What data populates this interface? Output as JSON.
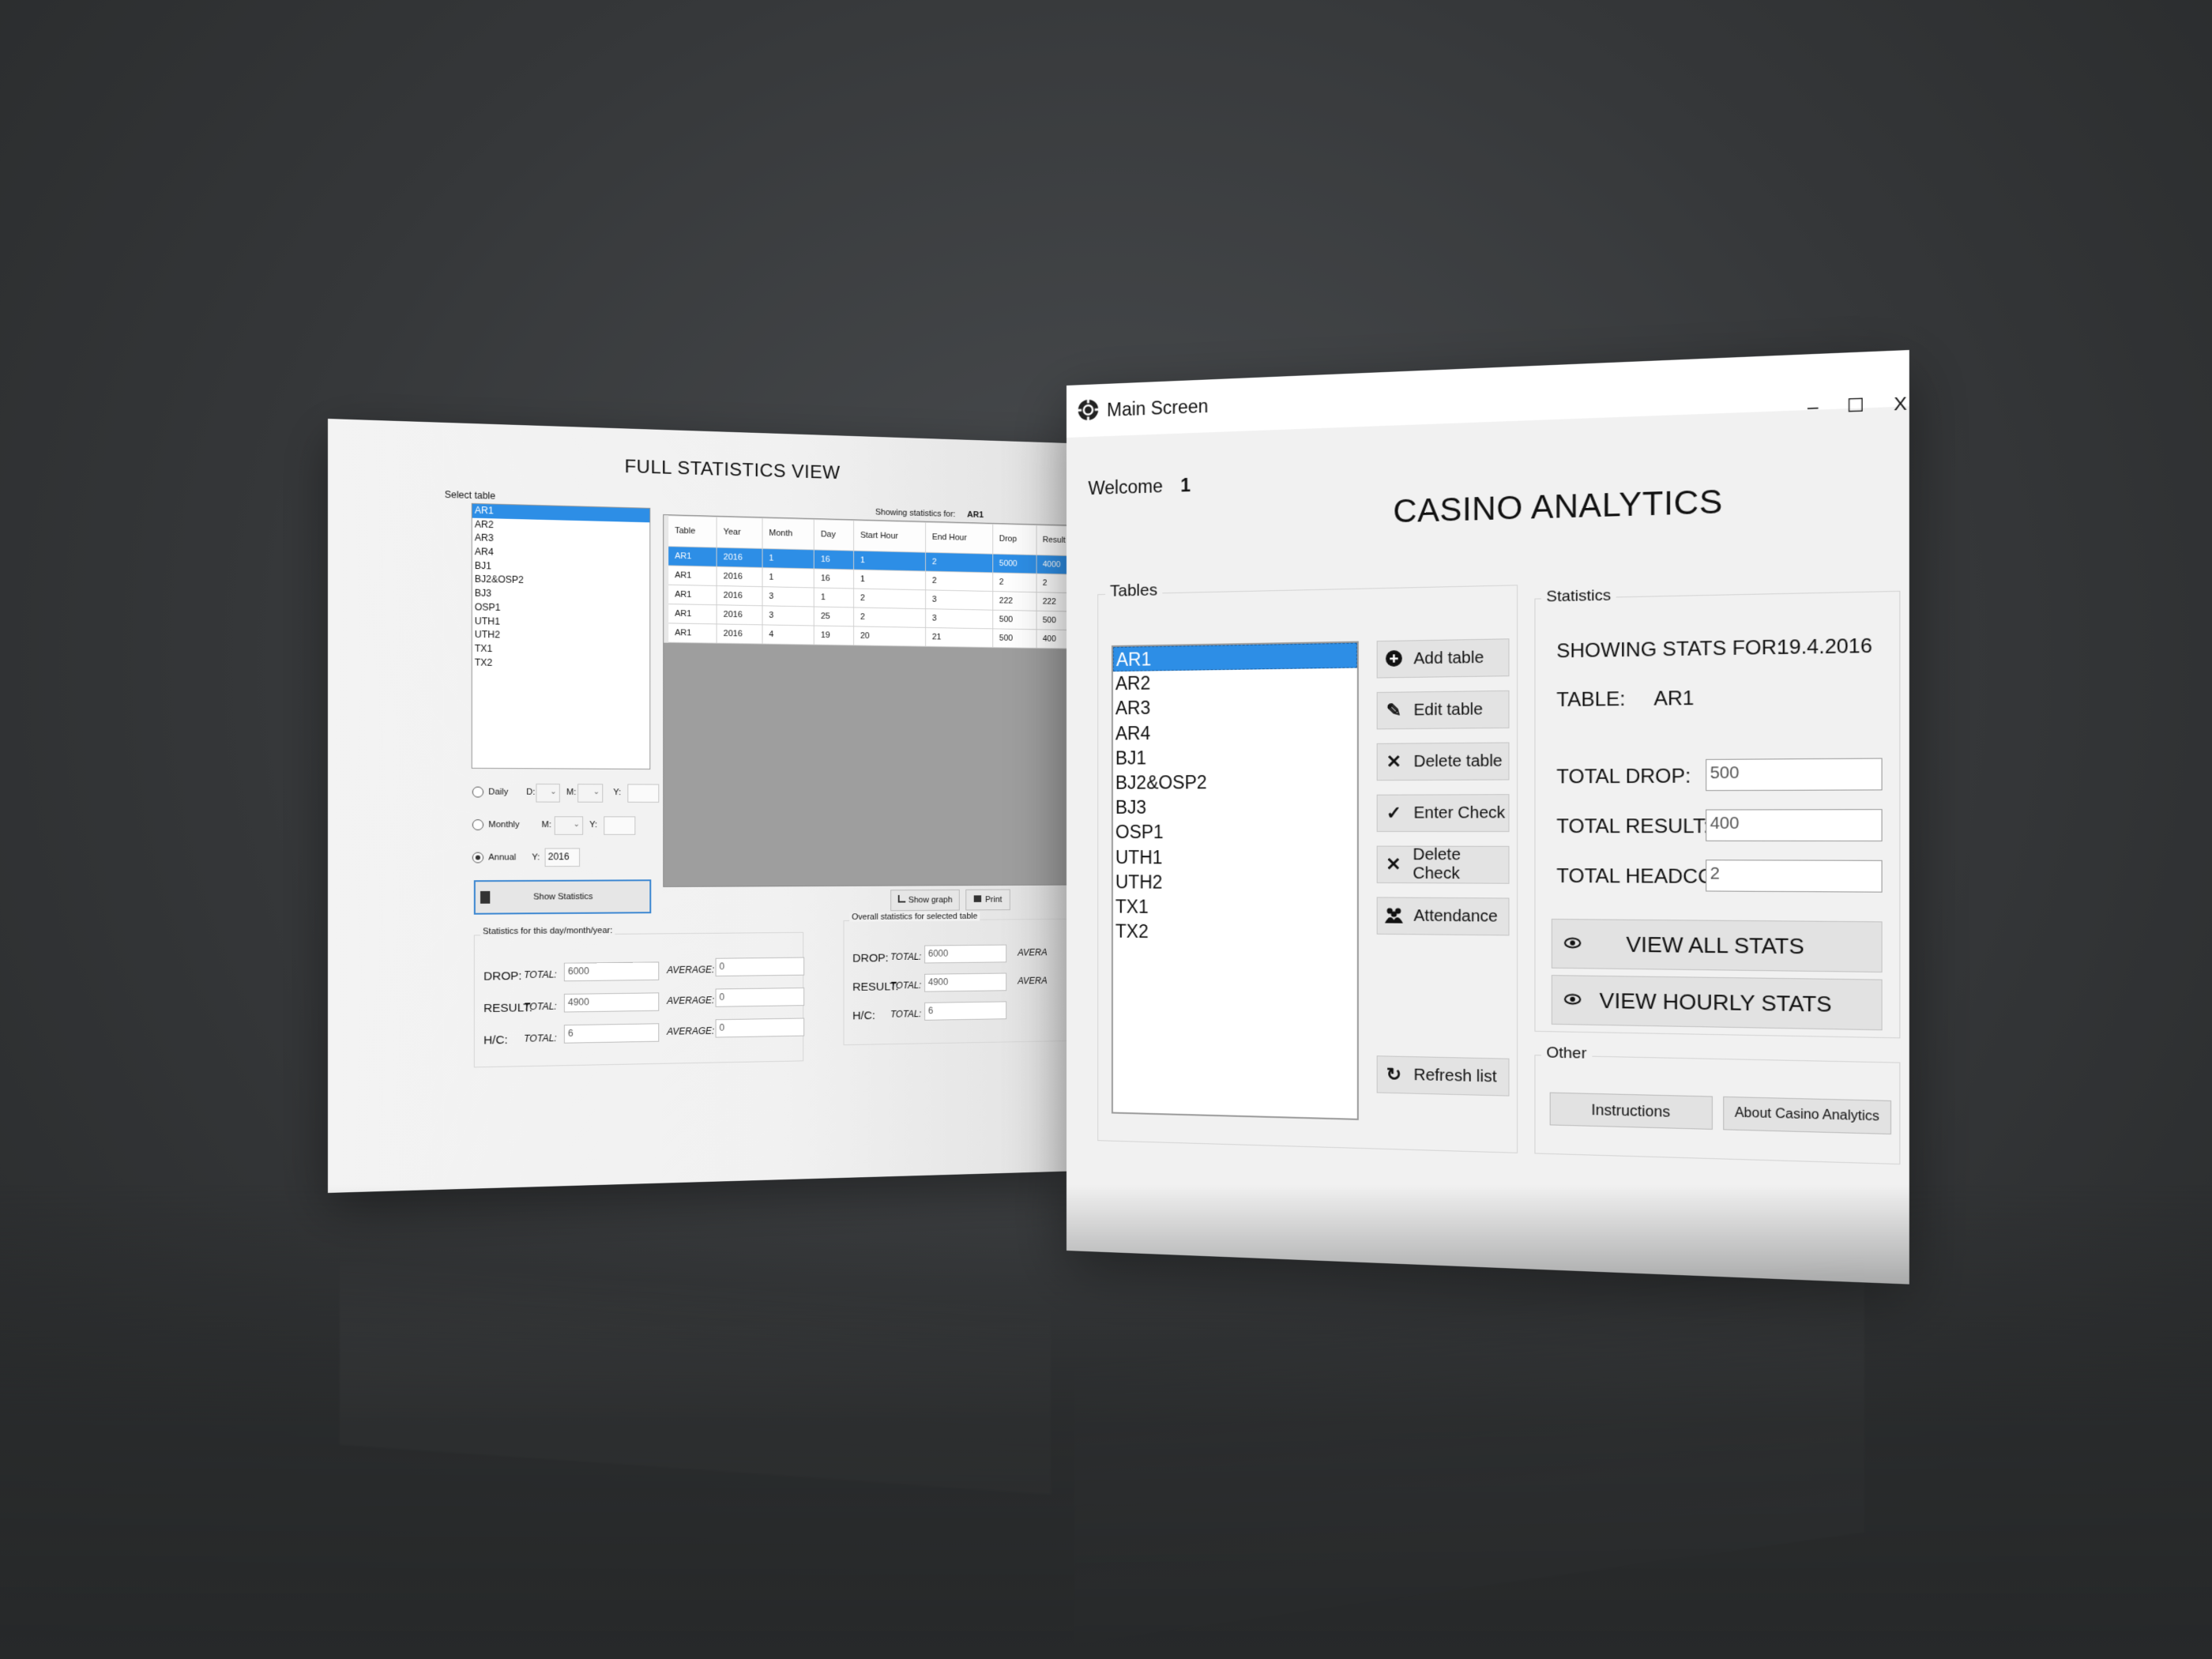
{
  "stats_window": {
    "title": "FULL STATISTICS VIEW",
    "select_table_label": "Select table",
    "tables": [
      "AR1",
      "AR2",
      "AR3",
      "AR4",
      "BJ1",
      "BJ2&OSP2",
      "BJ3",
      "OSP1",
      "UTH1",
      "UTH2",
      "TX1",
      "TX2"
    ],
    "selected_table": "AR1",
    "showing_for_label": "Showing statistics for:",
    "showing_for_value": "AR1",
    "grid": {
      "columns": [
        "Table",
        "Year",
        "Month",
        "Day",
        "Start Hour",
        "End Hour",
        "Drop",
        "Result"
      ],
      "rows": [
        [
          "AR1",
          "2016",
          "1",
          "16",
          "1",
          "2",
          "5000",
          "4000"
        ],
        [
          "AR1",
          "2016",
          "1",
          "16",
          "1",
          "2",
          "2",
          "2"
        ],
        [
          "AR1",
          "2016",
          "3",
          "1",
          "2",
          "3",
          "222",
          "222"
        ],
        [
          "AR1",
          "2016",
          "3",
          "25",
          "2",
          "3",
          "500",
          "500"
        ],
        [
          "AR1",
          "2016",
          "4",
          "19",
          "20",
          "21",
          "500",
          "400"
        ]
      ]
    },
    "period": {
      "daily_label": "Daily",
      "d_label": "D:",
      "m_label": "M:",
      "y_label": "Y:",
      "monthly_label": "Monthly",
      "monthly_m_label": "M:",
      "monthly_y_label": "Y:",
      "annual_label": "Annual",
      "annual_y_label": "Y:",
      "annual_year": "2016",
      "selected": "Annual"
    },
    "show_statistics_button": "Show Statistics",
    "show_graph_button": "Show graph",
    "print_button": "Print",
    "period_stats": {
      "caption": "Statistics for this day/month/year:",
      "drop_label": "DROP:",
      "result_label": "RESULT:",
      "hc_label": "H/C:",
      "total_label": "TOTAL:",
      "average_label": "AVERAGE:",
      "drop_total": "6000",
      "drop_average": "0",
      "result_total": "4900",
      "result_average": "0",
      "hc_total": "6",
      "hc_average": "0"
    },
    "overall_stats": {
      "caption": "Overall statistics for selected table",
      "drop_label": "DROP:",
      "result_label": "RESULT:",
      "hc_label": "H/C:",
      "total_label": "TOTAL:",
      "average_label": "AVERA",
      "drop_total": "6000",
      "result_total": "4900",
      "hc_total": "6"
    }
  },
  "main_window": {
    "window_title": "Main Screen",
    "controls": {
      "minimize": "–",
      "maximize": "☐",
      "close": "X"
    },
    "welcome_label": "Welcome",
    "welcome_user": "1",
    "app_title": "CASINO ANALYTICS",
    "tables_group": "Tables",
    "tables": [
      "AR1",
      "AR2",
      "AR3",
      "AR4",
      "BJ1",
      "BJ2&OSP2",
      "BJ3",
      "OSP1",
      "UTH1",
      "UTH2",
      "TX1",
      "TX2"
    ],
    "selected_table": "AR1",
    "buttons": {
      "add_table": "Add table",
      "edit_table": "Edit table",
      "delete_table": "Delete table",
      "enter_check": "Enter Check",
      "delete_check": "Delete Check",
      "attendance": "Attendance",
      "refresh_list": "Refresh list"
    },
    "statistics": {
      "group": "Statistics",
      "showing_for_label": "SHOWING STATS FOR:",
      "showing_for_value": "19.4.2016",
      "table_label": "TABLE:",
      "table_value": "AR1",
      "total_drop_label": "TOTAL DROP:",
      "total_drop_value": "500",
      "total_result_label": "TOTAL RESULT:",
      "total_result_value": "400",
      "total_headcount_label": "TOTAL HEADCOUNT:",
      "total_headcount_value": "2",
      "view_all_stats": "VIEW ALL STATS",
      "view_hourly_stats": "VIEW HOURLY STATS"
    },
    "other": {
      "group": "Other",
      "instructions": "Instructions",
      "about": "About Casino Analytics"
    }
  },
  "colors": {
    "selection": "#2d8ee6",
    "background": "#353739"
  }
}
